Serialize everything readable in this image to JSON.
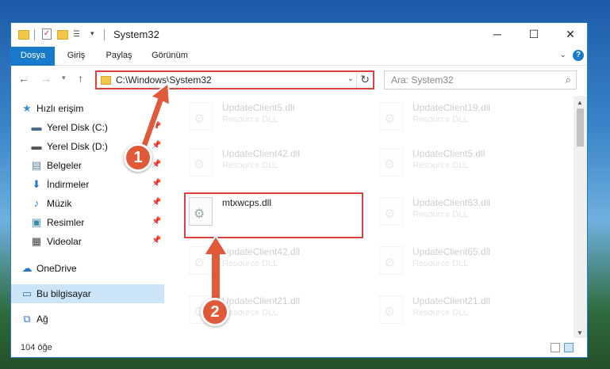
{
  "window": {
    "title": "System32",
    "min_glyph": "─",
    "max_glyph": "☐",
    "close_glyph": "✕"
  },
  "ribbon": {
    "tabs": [
      "Dosya",
      "Giriş",
      "Paylaş",
      "Görünüm"
    ],
    "help": "?",
    "expand_glyph": "⌄"
  },
  "nav": {
    "address": "C:\\Windows\\System32",
    "search_placeholder": "Ara: System32"
  },
  "sidebar": {
    "items": [
      {
        "label": "Hızlı erişim",
        "icon": "star-icon",
        "glyph": "★",
        "color": "#3b8fd8"
      },
      {
        "label": "Yerel Disk (C:)",
        "icon": "drive-icon",
        "glyph": "▬",
        "color": "#4a6a8a"
      },
      {
        "label": "Yerel Disk (D:)",
        "icon": "drive-icon",
        "glyph": "▬",
        "color": "#555555"
      },
      {
        "label": "Belgeler",
        "icon": "documents-icon",
        "glyph": "▤",
        "color": "#5a7fa8"
      },
      {
        "label": "İndirmeler",
        "icon": "download-icon",
        "glyph": "⬇",
        "color": "#2a78c8"
      },
      {
        "label": "Müzik",
        "icon": "music-icon",
        "glyph": "♪",
        "color": "#2a78c8"
      },
      {
        "label": "Resimler",
        "icon": "pictures-icon",
        "glyph": "▣",
        "color": "#3c8ab0"
      },
      {
        "label": "Videolar",
        "icon": "videos-icon",
        "glyph": "▦",
        "color": "#444444"
      },
      {
        "label": "OneDrive",
        "icon": "cloud-icon",
        "glyph": "☁",
        "color": "#2a78c8"
      },
      {
        "label": "Bu bilgisayar",
        "icon": "computer-icon",
        "glyph": "▭",
        "color": "#2a78c8"
      },
      {
        "label": "Ağ",
        "icon": "network-icon",
        "glyph": "⧉",
        "color": "#2a78c8"
      }
    ],
    "pin_glyph": "📌"
  },
  "files": [
    {
      "name": "UpdateClient5.dll",
      "type": "Resource DLL"
    },
    {
      "name": "UpdateClient19.dll",
      "type": "Resource DLL"
    },
    {
      "name": "UpdateClient42.dll",
      "type": "Resource DLL"
    },
    {
      "name": "UpdateClient5.dll",
      "type": "Resource DLL"
    },
    {
      "name": "mtxwcps.dll",
      "type": ""
    },
    {
      "name": "UpdateClient63.dll",
      "type": "Resource DLL"
    },
    {
      "name": "UpdateClient42.dll",
      "type": "Resource DLL"
    },
    {
      "name": "UpdateClient65.dll",
      "type": "Resource DLL"
    },
    {
      "name": "UpdateClient21.dll",
      "type": "Resource DLL"
    },
    {
      "name": "UpdateClient21.dll",
      "type": "Resource DLL"
    }
  ],
  "status": {
    "count": "104 öğe"
  },
  "callouts": [
    "1",
    "2"
  ],
  "colors": {
    "accent": "#1979ca",
    "highlight": "#d9433b",
    "callout": "#e05a3a"
  }
}
